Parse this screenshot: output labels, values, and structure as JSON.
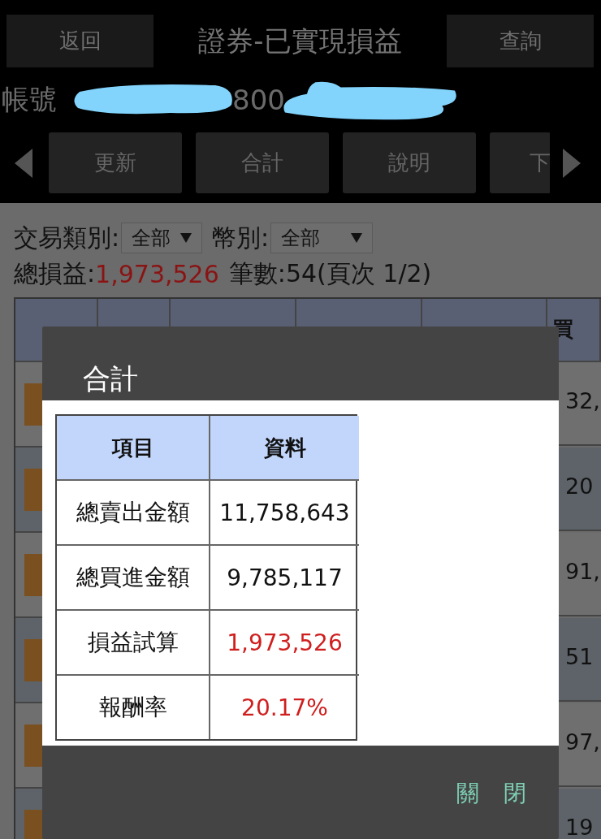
{
  "top_bar": {
    "back_button": "返回",
    "title": "證券-已實現損益",
    "query_button": "查詢"
  },
  "account": {
    "label": "帳號",
    "visible_digits": "800"
  },
  "toolbar": {
    "buttons": [
      {
        "label": "更新"
      },
      {
        "label": "合計"
      },
      {
        "label": "說明"
      },
      {
        "label": "下"
      }
    ]
  },
  "filters": [
    {
      "label": "交易類別:",
      "value": "全部"
    },
    {
      "label": "幣別:",
      "value": "全部"
    }
  ],
  "summary": {
    "total_label": "總損益:",
    "total_value": "1,973,526",
    "count_text": "筆數:54(頁次 1/2)"
  },
  "table": {
    "column_6_header": "買",
    "rows": [
      {
        "column_6": "32,"
      },
      {
        "column_6": "20"
      },
      {
        "column_6": "91,"
      },
      {
        "column_6": "51"
      },
      {
        "column_6": "97,"
      },
      {
        "column_6": "19"
      }
    ]
  },
  "dialog": {
    "title": "合計",
    "columns": [
      "項目",
      "資料"
    ],
    "rows": [
      {
        "item": "總賣出金額",
        "value": "11,758,643",
        "highlight": false
      },
      {
        "item": "總買進金額",
        "value": "9,785,117",
        "highlight": false
      },
      {
        "item": "損益試算",
        "value": "1,973,526",
        "highlight": true
      },
      {
        "item": "報酬率",
        "value": "20.17%",
        "highlight": true
      }
    ],
    "close_button": "關閉"
  }
}
